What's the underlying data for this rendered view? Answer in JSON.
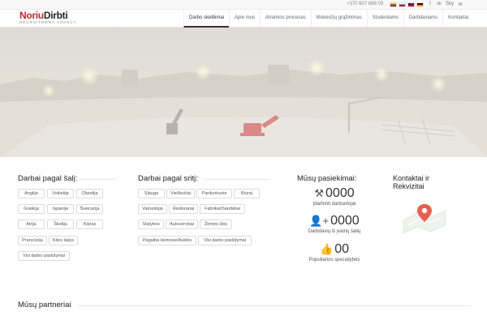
{
  "topbar": {
    "phone": "+370 607 888 09",
    "flags": [
      "lt",
      "ru",
      "uk",
      "de"
    ],
    "socials": [
      "facebook-icon",
      "vk-icon",
      "skype-icon",
      "mail-icon"
    ],
    "social_glyphs": [
      "f",
      "vk",
      "Sky",
      "✉"
    ]
  },
  "header": {
    "logo_main_a": "Noriu",
    "logo_main_b": "Dirbti",
    "logo_sub": "RECRUITMENT AGENCY",
    "nav": [
      "Darbo skelbimai",
      "Apie mus",
      "Atrankos procesas",
      "Mokesčių grąžinimas",
      "Studentams",
      "Darbdaviams",
      "Kontaktai"
    ],
    "active_nav": "Darbo skelbimai"
  },
  "countries": {
    "title": "Darbai pagal šalį:",
    "tags": [
      "Anglija",
      "Vokietija",
      "Olandija",
      "Graikija",
      "Ispanija",
      "Šveicarija",
      "Airija",
      "Škotija",
      "Kipras",
      "Prancūzija",
      "Kitos šalys",
      "Visi darbo pasiūlymai"
    ]
  },
  "fields": {
    "title": "Darbai pagal sritį:",
    "tags": [
      "Slauga",
      "Viešbučiai",
      "Parduotuvės",
      "Biurai",
      "Vairuotojai",
      "Restoranai",
      "Fabrikai/Sandėliai",
      "Statybos",
      "Autoservisai",
      "Žemės ūkis",
      "Pagalba šeimose/Auklės",
      "Visi darbo pasiūlymai"
    ]
  },
  "achievements": {
    "title": "Mūsų pasiekimai:",
    "items": [
      {
        "icon": "tools-icon",
        "glyph": "⚒",
        "value": "0000",
        "label": "Įdarbinti darbuotojai"
      },
      {
        "icon": "user-plus-icon",
        "glyph": "👤+",
        "value": "0000",
        "label": "Darbdavių iš įvairių šalių"
      },
      {
        "icon": "thumbs-up-icon",
        "glyph": "👍",
        "value": "00",
        "label": "Populiarios specialybės"
      }
    ]
  },
  "contacts": {
    "title": "Kontaktai ir Rekvizitai"
  },
  "partners": {
    "title": "Mūsų partneriai"
  },
  "colors": {
    "brand_red": "#c0282d",
    "map_pin": "#e8604c"
  }
}
